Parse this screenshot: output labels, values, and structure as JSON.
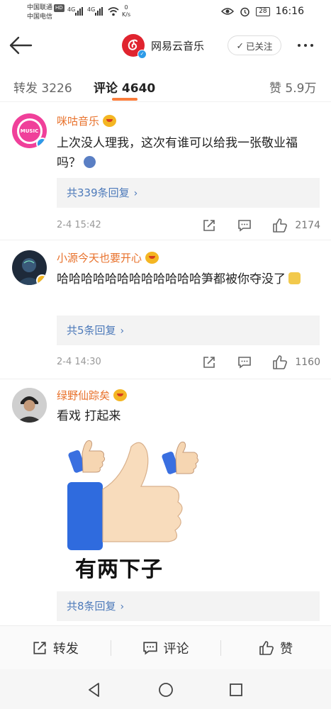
{
  "status_bar": {
    "carrier1": "中国联通",
    "carrier2": "中国电信",
    "hd": "HD",
    "net1": "4G",
    "net2": "4G",
    "speed_value": "0",
    "speed_unit": "K/s",
    "battery": "28",
    "time": "16:16"
  },
  "header": {
    "account_name": "网易云音乐",
    "follow_label": "已关注",
    "brand_color": "#e0242f"
  },
  "tabs": [
    {
      "label": "转发 3226",
      "active": false
    },
    {
      "label": "评论 4640",
      "active": true
    },
    {
      "label": "赞 5.9万",
      "active": false
    }
  ],
  "comments": [
    {
      "username": "咪咕音乐",
      "avatar_text": "MUSIC",
      "text": "上次没人理我，这次有谁可以给我一张敬业福吗？",
      "replies": "共339条回复",
      "date": "2-4 15:42",
      "likes": "2174"
    },
    {
      "username": "小源今天也要开心",
      "text": "哈哈哈哈哈哈哈哈哈哈哈哈笋都被你夺没了",
      "replies": "共5条回复",
      "date": "2-4 14:30",
      "likes": "1160"
    },
    {
      "username": "绿野仙踪矣",
      "text": "看戏 打起来",
      "sticker_text": "有两下子",
      "replies": "共8条回复"
    }
  ],
  "bottom_bar": {
    "repost": "转发",
    "comment": "评论",
    "like": "赞"
  },
  "colors": {
    "accent_orange": "#fa7d3c",
    "username_orange": "#e8712b",
    "link_blue": "#4d7aba"
  }
}
